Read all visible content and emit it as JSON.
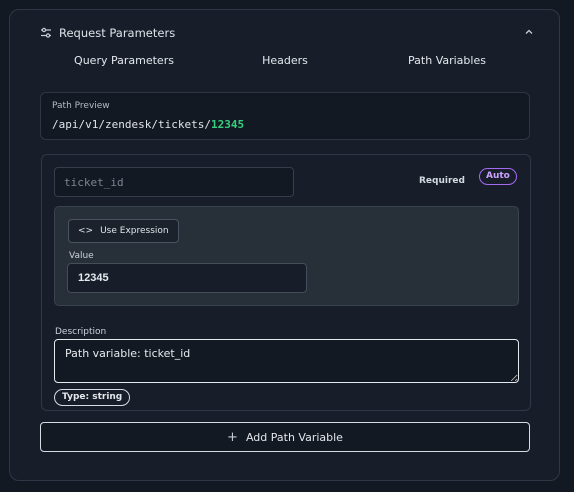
{
  "panel": {
    "title": "Request Parameters",
    "tabs": [
      {
        "label": "Query Parameters"
      },
      {
        "label": "Headers"
      },
      {
        "label": "Path Variables"
      }
    ]
  },
  "path_preview": {
    "label": "Path Preview",
    "base": "/api/v1/zendesk/tickets/",
    "variable_value": "12345"
  },
  "path_variable": {
    "name_placeholder": "ticket_id",
    "required_label": "Required",
    "auto_badge": "Auto",
    "use_expression_label": "Use Expression",
    "value_label": "Value",
    "value": "12345",
    "description_label": "Description",
    "description": "Path variable: ticket_id",
    "type_badge": "Type: string"
  },
  "add_button_label": "Add Path Variable",
  "colors": {
    "accent_green": "#35d07f",
    "accent_purple": "#a46af2",
    "background": "#131923"
  }
}
